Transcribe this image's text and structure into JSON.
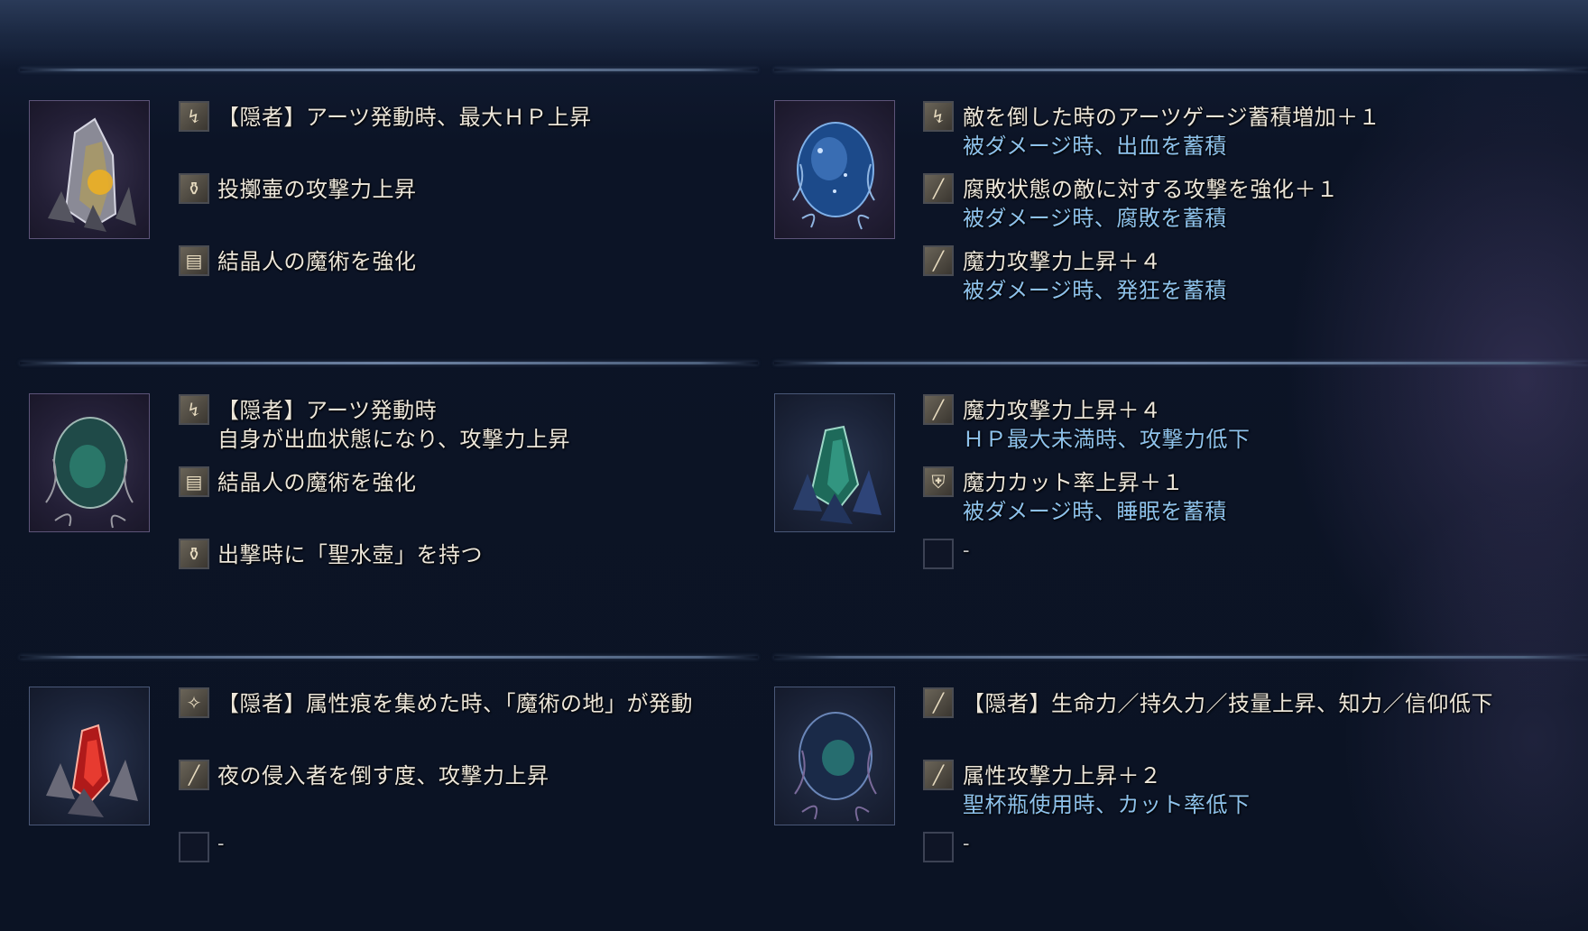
{
  "colors": {
    "effect_text": "#ece6da",
    "debuff_text": "#8ec2ec",
    "background": "#0b1222",
    "divider": "#6d82a2"
  },
  "relics": [
    {
      "image": "yellow-crystal-relic-icon",
      "effects": [
        {
          "icon": "sword-skill-icon",
          "text": "【隠者】アーツ発動時、最大ＨＰ上昇"
        },
        {
          "icon": "pot-icon",
          "text": "投擲壷の攻撃力上昇"
        },
        {
          "icon": "scroll-icon",
          "text": "結晶人の魔術を強化"
        }
      ]
    },
    {
      "image": "blue-orb-relic-icon",
      "effects": [
        {
          "icon": "sword-skill-icon",
          "text": "敵を倒した時のアーツゲージ蓄積増加＋１",
          "sub": "被ダメージ時、出血を蓄積"
        },
        {
          "icon": "sword-icon",
          "text": "腐敗状態の敵に対する攻撃を強化＋１",
          "sub": "被ダメージ時、腐敗を蓄積"
        },
        {
          "icon": "sword-icon",
          "text": "魔力攻撃力上昇＋４",
          "sub": "被ダメージ時、発狂を蓄積"
        }
      ]
    },
    {
      "image": "green-egg-relic-icon",
      "effects": [
        {
          "icon": "sword-skill-icon",
          "text": "【隠者】アーツ発動時",
          "text2": "自身が出血状態になり、攻撃力上昇"
        },
        {
          "icon": "scroll-icon",
          "text": "結晶人の魔術を強化"
        },
        {
          "icon": "pot-icon",
          "text": "出撃時に「聖水壺」を持つ"
        }
      ]
    },
    {
      "image": "green-crystal-relic-icon",
      "effects": [
        {
          "icon": "sword-icon",
          "text": "魔力攻撃力上昇＋４",
          "sub": "ＨＰ最大未満時、攻撃力低下"
        },
        {
          "icon": "shield-icon",
          "text": "魔力カット率上昇＋１",
          "sub": "被ダメージ時、睡眠を蓄積"
        },
        {
          "icon": "empty-slot-icon",
          "text": "-"
        }
      ]
    },
    {
      "image": "red-crystal-relic-icon",
      "effects": [
        {
          "icon": "magic-icon",
          "text": "【隠者】属性痕を集めた時、「魔術の地」が発動"
        },
        {
          "icon": "sword-icon",
          "text": "夜の侵入者を倒す度、攻撃力上昇"
        },
        {
          "icon": "empty-slot-icon",
          "text": "-"
        }
      ]
    },
    {
      "image": "dark-orb-relic-icon",
      "effects": [
        {
          "icon": "sword-icon",
          "text": "【隠者】生命力／持久力／技量上昇、知力／信仰低下"
        },
        {
          "icon": "sword-icon",
          "text": "属性攻撃力上昇＋２",
          "sub": "聖杯瓶使用時、カット率低下"
        },
        {
          "icon": "empty-slot-icon",
          "text": "-"
        }
      ]
    }
  ]
}
